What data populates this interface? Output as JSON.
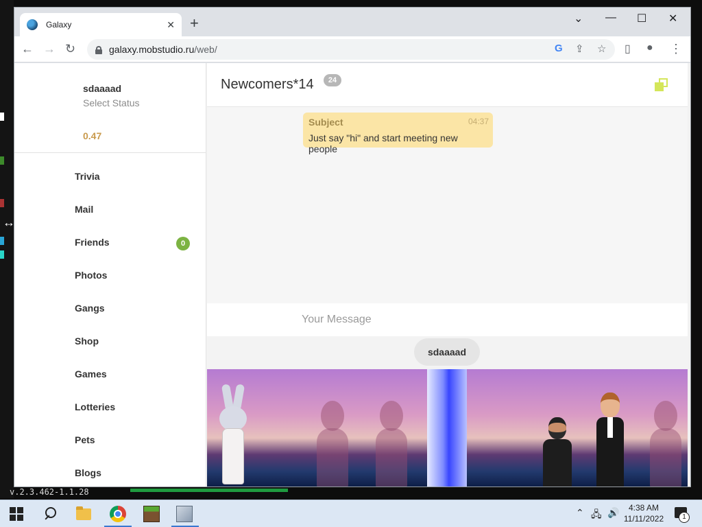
{
  "desktop": {
    "version": "v.2.3.462-1.1.28"
  },
  "browser": {
    "tab_title": "Galaxy",
    "tab_close": "✕",
    "new_tab": "+",
    "url_host": "galaxy.mobstudio.ru",
    "url_path": "/web/",
    "window_controls": {
      "tab_list": "⌄",
      "minimize": "—",
      "maximize": "☐",
      "close": "✕"
    },
    "nav": {
      "back": "←",
      "forward": "→",
      "reload": "↻"
    },
    "omnibox_icons": {
      "google": "G",
      "share": "⇪",
      "bookmark": "☆",
      "side_panel": "▯",
      "profile": "●",
      "menu": "⋮"
    }
  },
  "sidebar": {
    "username": "sdaaaad",
    "status": "Select Status",
    "balance": "0.47",
    "items": [
      {
        "label": "Trivia"
      },
      {
        "label": "Mail"
      },
      {
        "label": "Friends",
        "badge": "0"
      },
      {
        "label": "Photos"
      },
      {
        "label": "Gangs"
      },
      {
        "label": "Shop"
      },
      {
        "label": "Games"
      },
      {
        "label": "Lotteries"
      },
      {
        "label": "Pets"
      },
      {
        "label": "Blogs"
      }
    ]
  },
  "chat": {
    "room_title": "Newcomers*14",
    "room_count": "24",
    "message": {
      "subject": "Subject",
      "time": "04:37",
      "text": "Just say \"hi\" and start meeting new people"
    },
    "input_placeholder": "Your Message",
    "stage_user": "sdaaaad"
  },
  "taskbar": {
    "tray_chevron": "⌃",
    "tray_network": "🖧",
    "tray_volume": "🔊",
    "time": "4:38 AM",
    "date": "11/11/2022",
    "notification_count": "1"
  },
  "colors": {
    "accent_badge": "#7cb342",
    "balance": "#c99a4d",
    "message_bubble": "#fbe5a6"
  }
}
